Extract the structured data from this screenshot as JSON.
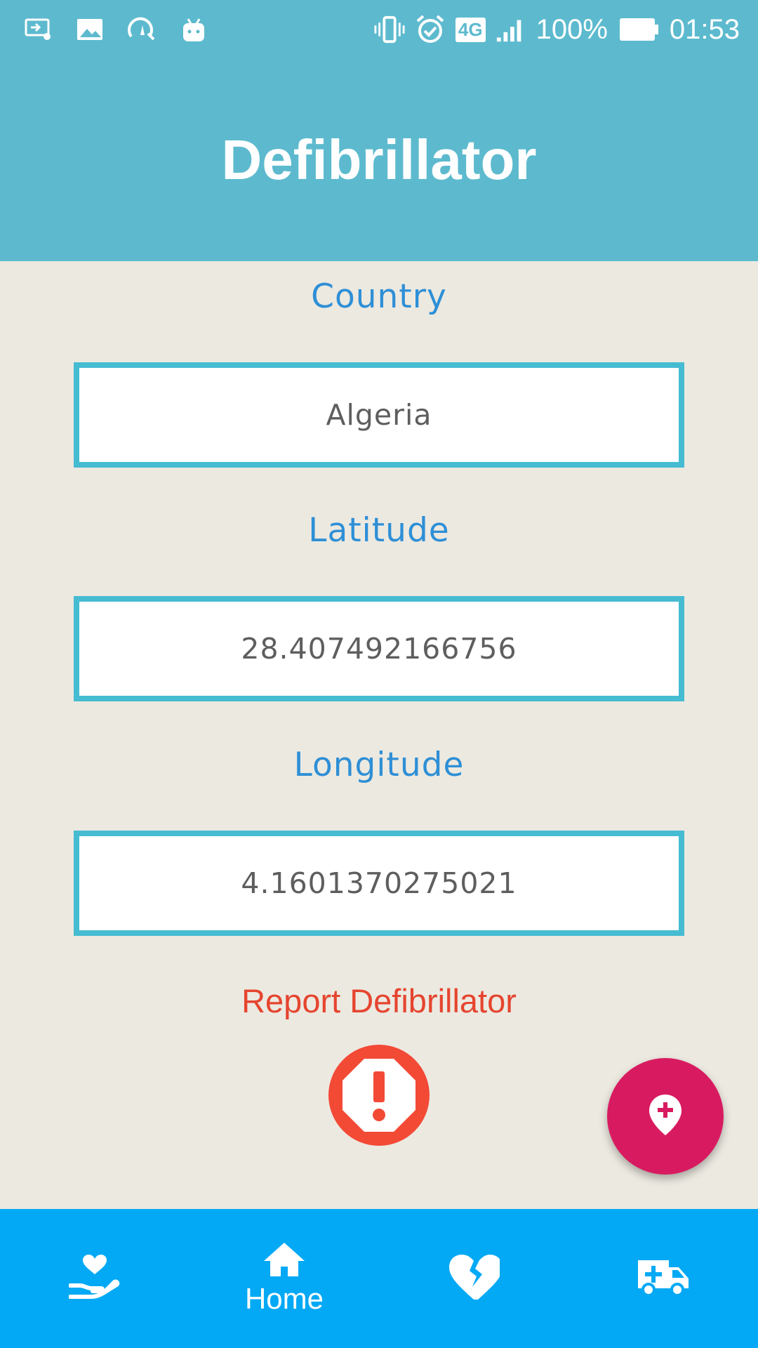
{
  "status_bar": {
    "left_icons": [
      "cast-icon",
      "image-icon",
      "speed-icon",
      "android-icon"
    ],
    "right_icons": [
      "vibrate-icon",
      "alarm-icon",
      "network-4g-icon",
      "signal-icon",
      "battery-icon"
    ],
    "network_type": "4G",
    "battery_percent": "100%",
    "time": "01:53"
  },
  "header": {
    "title": "Defibrillator"
  },
  "form": {
    "country": {
      "label": "Country",
      "value": "Algeria"
    },
    "latitude": {
      "label": "Latitude",
      "value": "28.407492166756"
    },
    "longitude": {
      "label": "Longitude",
      "value": "4.1601370275021"
    }
  },
  "report": {
    "label": "Report Defibrillator",
    "icon": "alert-octagon-icon"
  },
  "fab": {
    "icon": "add-location-icon"
  },
  "bottom_nav": {
    "items": [
      {
        "icon": "heart-hand-icon",
        "label": ""
      },
      {
        "icon": "home-icon",
        "label": "Home"
      },
      {
        "icon": "broken-heart-icon",
        "label": ""
      },
      {
        "icon": "ambulance-icon",
        "label": ""
      }
    ]
  },
  "colors": {
    "header": "#5DBACE",
    "background": "#ECE9E1",
    "label_blue": "#2E8FD6",
    "field_border": "#45BCD1",
    "report_red": "#E5452F",
    "fab": "#D81B60",
    "bottom_nav": "#03A9F4"
  }
}
